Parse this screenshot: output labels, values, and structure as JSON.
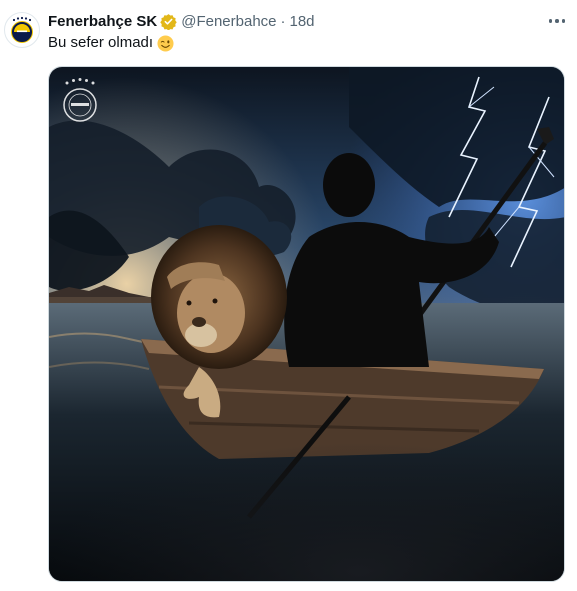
{
  "tweet": {
    "display_name": "Fenerbahçe SK",
    "handle": "@Fenerbahce",
    "separator": "·",
    "timestamp": "18d",
    "text": "Bu sefer olmadı",
    "emoji_icon": "winking-face-emoji",
    "avatar_icon": "fenerbahce-crest",
    "verified_badge_color": "#E2B719",
    "media": {
      "description_icon": "lion-and-silhouette-in-boat-artwork",
      "crest_icon": "fenerbahce-crest-watermark"
    }
  },
  "colors": {
    "text_primary": "#0f1419",
    "text_secondary": "#536471",
    "border": "#cfd9de",
    "club_navy": "#0b1a4a",
    "club_yellow": "#f3c800"
  }
}
